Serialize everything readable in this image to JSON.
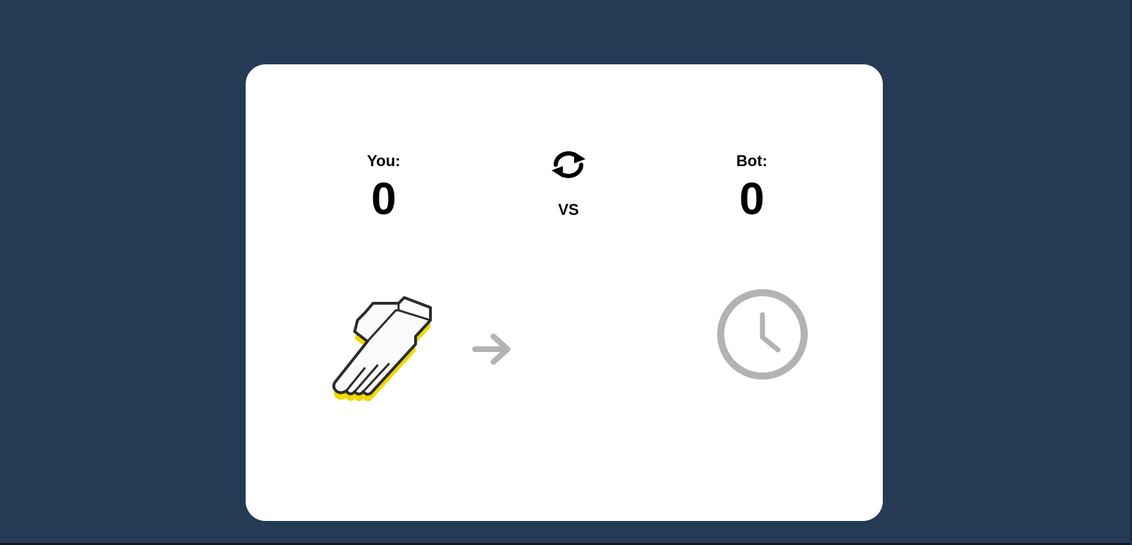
{
  "player": {
    "label": "You:",
    "score": "0",
    "choice": "paper-hand-icon"
  },
  "bot": {
    "label": "Bot:",
    "score": "0",
    "state": "clock-icon"
  },
  "center": {
    "vs_label": "VS",
    "reset_icon": "refresh-icon",
    "arrow_icon": "arrow-right-icon"
  },
  "colors": {
    "background": "#253a55",
    "card": "#ffffff",
    "hand_shadow": "#f0d800",
    "inactive_icon": "#b3b3b3"
  }
}
